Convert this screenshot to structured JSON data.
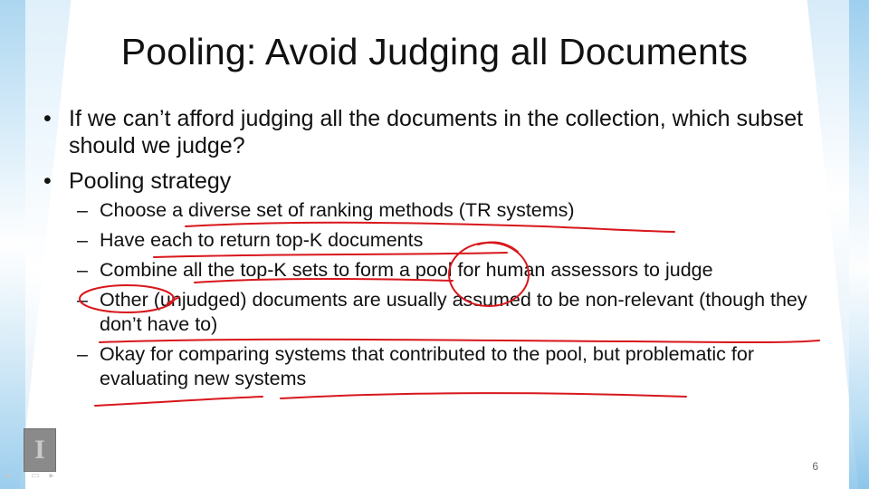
{
  "slide": {
    "title": "Pooling: Avoid Judging all Documents",
    "bullet_marker": "•",
    "dash_marker": "–",
    "bullets": [
      {
        "text": "If we can’t afford judging all the documents in the collection, which subset should we judge?"
      },
      {
        "text": "Pooling strategy",
        "sub": [
          "Choose a diverse set of ranking methods (TR systems)",
          "Have each to return top-K documents",
          "Combine all the top-K sets to form a pool for human assessors to judge",
          "Other (unjudged) documents are usually assumed to be non-relevant (though they don’t have to)",
          "Okay for comparing systems that contributed to the pool, but problematic for evaluating new systems"
        ]
      }
    ],
    "page_number": "6",
    "logo_glyph": "I",
    "nav_glyphs": "◂ ⁄ ▭ ▸"
  },
  "colors": {
    "annotation_ink": "#d8171c",
    "accent_blue": "#8ec8ec"
  },
  "icons": [
    "university-logo-icon",
    "slide-nav-icons"
  ]
}
